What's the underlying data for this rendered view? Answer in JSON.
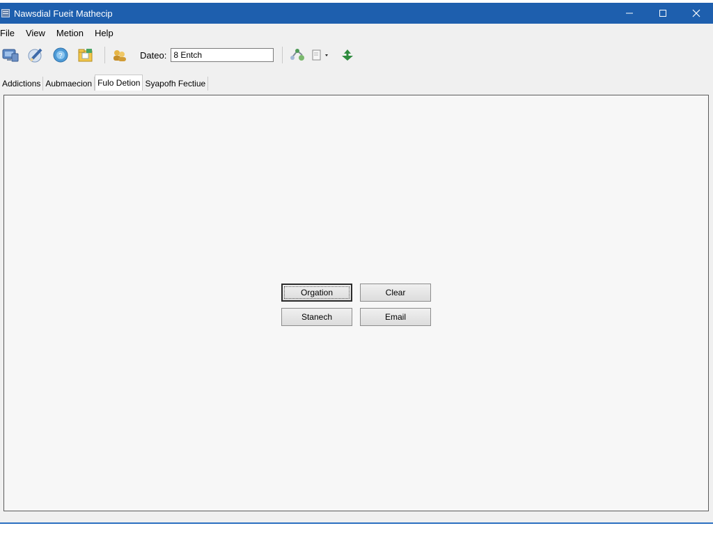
{
  "window": {
    "title": "Nawsdial Fueit Mathecip"
  },
  "menu": {
    "file": "File",
    "view": "View",
    "metion": "Metion",
    "help": "Help"
  },
  "toolbar": {
    "date_label": "Dateo:",
    "date_value": "8 Entch",
    "icons": [
      "computer-icon",
      "pencil-icon",
      "help-icon",
      "folder-icon",
      "users-icon",
      "network-icon",
      "document-dropdown-icon",
      "add-arrows-icon"
    ]
  },
  "tabs": [
    {
      "label": "Addictions"
    },
    {
      "label": "Aubmaecion"
    },
    {
      "label": "Fulo Detion",
      "active": true
    },
    {
      "label": "Syapofh Fectiue"
    }
  ],
  "buttons": {
    "orgation": "Orgation",
    "clear": "Clear",
    "stanech": "Stanech",
    "email": "Email"
  },
  "colors": {
    "titlebar": "#1e5fae",
    "accent_green": "#2e8b3d"
  }
}
